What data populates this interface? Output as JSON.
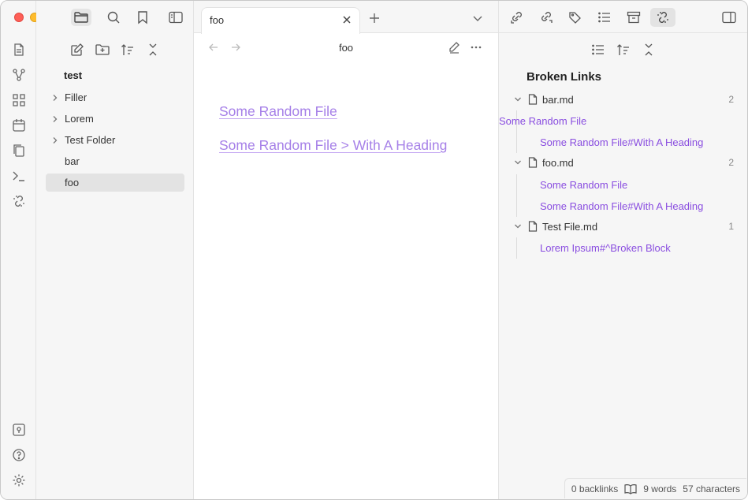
{
  "window": {
    "traffic_lights": [
      "close",
      "minimize",
      "zoom"
    ]
  },
  "left_toolbar": {
    "buttons": [
      "folder-icon",
      "search-icon",
      "bookmark-icon",
      "sidebar-toggle-icon"
    ]
  },
  "ribbon": {
    "top_icons": [
      "quick-switch-icon",
      "graph-icon",
      "canvas-icon",
      "daily-note-icon",
      "templates-icon",
      "command-palette-icon",
      "broken-links-icon"
    ],
    "bottom_icons": [
      "vault-switch-icon",
      "help-icon",
      "settings-icon"
    ]
  },
  "file_explorer": {
    "actions": [
      "new-note-icon",
      "new-folder-icon",
      "sort-icon",
      "collapse-icon"
    ],
    "vault_name": "test",
    "items": [
      {
        "label": "Filler",
        "type": "folder"
      },
      {
        "label": "Lorem",
        "type": "folder"
      },
      {
        "label": "Test Folder",
        "type": "folder"
      },
      {
        "label": "bar",
        "type": "file"
      },
      {
        "label": "foo",
        "type": "file",
        "selected": true
      }
    ]
  },
  "tabs": [
    {
      "title": "foo",
      "active": true
    }
  ],
  "view_header": {
    "title": "foo"
  },
  "document": {
    "links": [
      "Some Random File",
      "Some Random File > With A Heading"
    ]
  },
  "right_toolbar": {
    "buttons": [
      "backlinks-icon",
      "outgoing-links-icon",
      "tags-icon",
      "outline-icon",
      "archive-icon",
      "broken-links-icon",
      "sidebar-right-icon"
    ]
  },
  "broken_links": {
    "title": "Broken Links",
    "groups": [
      {
        "file": "bar.md",
        "count": "2",
        "items": [
          "Some Random File",
          "Some Random File#With A Heading"
        ]
      },
      {
        "file": "foo.md",
        "count": "2",
        "items": [
          "Some Random File",
          "Some Random File#With A Heading"
        ]
      },
      {
        "file": "Test File.md",
        "count": "1",
        "items": [
          "Lorem Ipsum#^Broken Block"
        ]
      }
    ]
  },
  "status_bar": {
    "backlinks": "0 backlinks",
    "words": "9 words",
    "characters": "57 characters"
  },
  "colors": {
    "accent_link": "#a680e8",
    "accent_item": "#8a4ee0"
  }
}
